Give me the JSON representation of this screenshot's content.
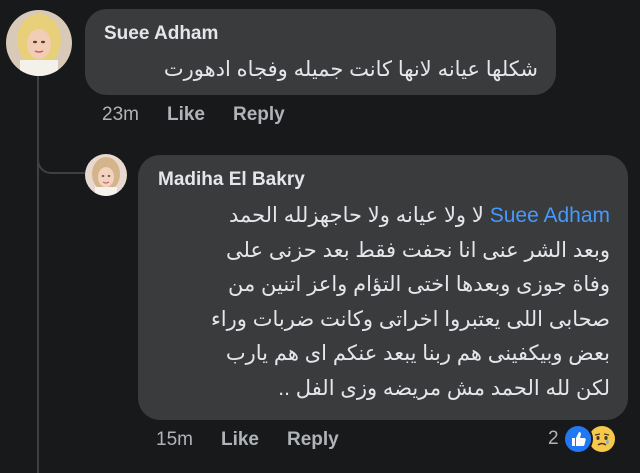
{
  "comment": {
    "author": "Suee Adham",
    "text": "شكلها عيانه لانها كانت جميله وفجاه  ادهورت",
    "time": "23m",
    "like_label": "Like",
    "reply_label": "Reply"
  },
  "reply": {
    "author": "Madiha El Bakry",
    "mention": "Suee Adham",
    "lines": [
      "لا ولا عيانه ولا حاجهزلله الحمد",
      "وبعد الشر عنى انا نحفت فقط بعد حزنى على",
      "وفاة جوزى وبعدها اختى التؤام واعز اتنين من",
      "صحابى اللى يعتبروا اخراتى وكانت ضربات وراء",
      "بعض وبيكفينى هم ربنا يبعد عنكم اى هم يارب",
      "لكن لله الحمد مش مريضه وزى الفل .."
    ],
    "time": "15m",
    "like_label": "Like",
    "reply_label": "Reply",
    "reaction_count": "2",
    "reactions": [
      "like-icon",
      "sad-icon"
    ]
  },
  "colors": {
    "background": "#18191a",
    "bubble": "#3a3b3c",
    "text": "#e4e6eb",
    "secondary": "#b0b3b8",
    "mention": "#4599ff",
    "like_blue": "#2078f4",
    "sad_yellow": "#f7c94b"
  }
}
